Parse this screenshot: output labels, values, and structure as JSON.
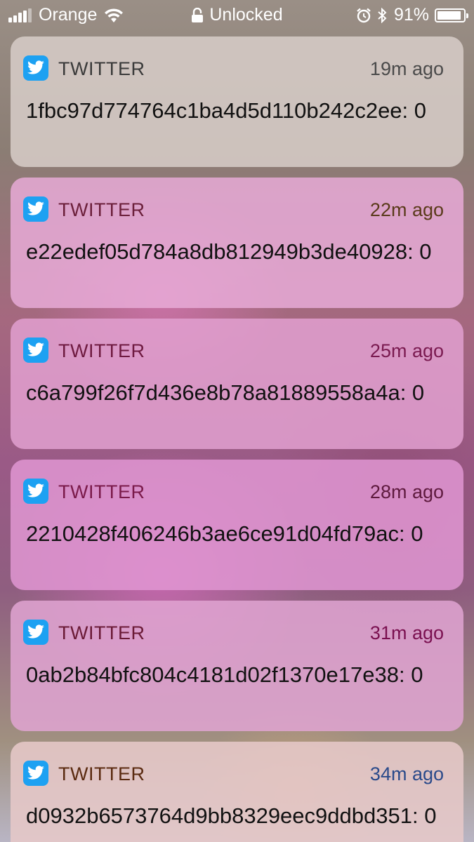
{
  "status_bar": {
    "carrier": "Orange",
    "center_text": "Unlocked",
    "battery_percent": "91%",
    "battery_level": 0.91
  },
  "notifications": [
    {
      "app": "TWITTER",
      "time": "19m ago",
      "body": "1fbc97d774764c1ba4d5d110b242c2ee: 0",
      "app_color": "#3a3a3a",
      "time_color": "#4a4a4a",
      "bg": "rgba(215,205,200,0.86)"
    },
    {
      "app": "TWITTER",
      "time": "22m ago",
      "body": "e22edef05d784a8db812949b3de40928: 0",
      "app_color": "#6b1f3a",
      "time_color": "#5a3a1a",
      "bg": "rgba(232,170,215,0.85)"
    },
    {
      "app": "TWITTER",
      "time": "25m ago",
      "body": "c6a799f26f7d436e8b78a81889558a4a: 0",
      "app_color": "#6e1a40",
      "time_color": "#7a1a50",
      "bg": "rgba(226,160,208,0.85)"
    },
    {
      "app": "TWITTER",
      "time": "28m ago",
      "body": "2210428f406246b3ae6ce91d04fd79ac: 0",
      "app_color": "#7a1a4a",
      "time_color": "#5e1a3e",
      "bg": "rgba(225,150,210,0.85)"
    },
    {
      "app": "TWITTER",
      "time": "31m ago",
      "body": "0ab2b84bfc804c4181d02f1370e17e38: 0",
      "app_color": "#6a1a36",
      "time_color": "#7a1050",
      "bg": "rgba(225,165,210,0.85)"
    },
    {
      "app": "TWITTER",
      "time": "34m ago",
      "body": "d0932b6573764d9bb8329eec9ddbd351: 0",
      "app_color": "#5a2a10",
      "time_color": "#2a4a8a",
      "bg": "rgba(230,200,200,0.88)"
    }
  ]
}
